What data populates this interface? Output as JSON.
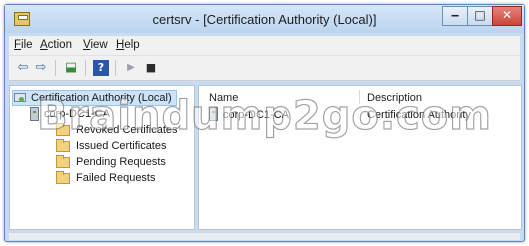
{
  "window": {
    "title": "certsrv - [Certification Authority (Local)]",
    "controls": {
      "minimize": "‒",
      "maximize": "□",
      "close": "✕"
    }
  },
  "menu": [
    "File",
    "Action",
    "View",
    "Help"
  ],
  "toolbar": {
    "icons": [
      "back-arrow-icon",
      "forward-arrow-icon",
      "export-list-icon",
      "help-icon",
      "start-service-icon",
      "stop-service-icon"
    ],
    "glyphs": {
      "back": "⇦",
      "forward": "⇨",
      "export": "⬓",
      "help": "?",
      "start": "▶",
      "stop": "■"
    }
  },
  "tree": {
    "root": "Certification Authority (Local)",
    "ca": "corp-DC1-CA",
    "folders": [
      "Revoked Certificates",
      "Issued Certificates",
      "Pending Requests",
      "Failed Requests"
    ]
  },
  "list": {
    "columns": [
      "Name",
      "Description"
    ],
    "rows": [
      {
        "name": "corp-DC1-CA",
        "description": "Certification Authority"
      }
    ]
  },
  "watermark": "Braindump2go.com",
  "colors": {
    "title_bg": "#c7dcf3",
    "close_button": "#c9463d",
    "selection": "#cde3f7"
  }
}
